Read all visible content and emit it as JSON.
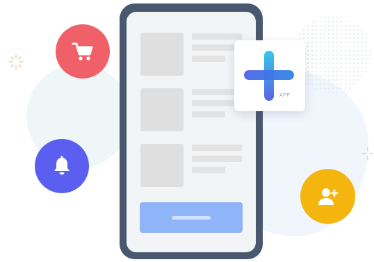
{
  "app_tile": {
    "label": "APP",
    "icon": "plus-icon"
  },
  "icons": {
    "cart": "shopping-cart-icon",
    "bell": "bell-icon",
    "user": "add-user-icon"
  },
  "colors": {
    "phone_frame": "#49586e",
    "screen": "#f3f4f6",
    "cart_circle": "#f06068",
    "bell_circle": "#5a5ff0",
    "user_circle": "#f4b50e",
    "cta_button": "#8fb5f8",
    "placeholder": "#dfdfdf"
  },
  "list_placeholders": [
    {
      "lines": 3
    },
    {
      "lines": 3
    },
    {
      "lines": 3
    }
  ]
}
